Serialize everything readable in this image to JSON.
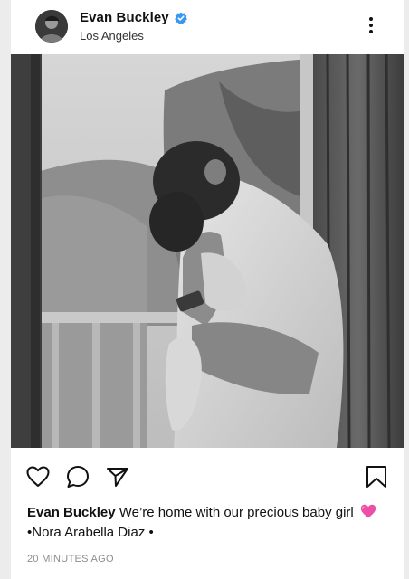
{
  "post": {
    "username": "Evan Buckley",
    "location": "Los Angeles",
    "verified": true,
    "caption_user": "Evan Buckley",
    "caption_line1": "We’re home with our precious baby girl",
    "caption_emoji": "pink-heart-emoji",
    "caption_line2": "•Nora Arabella Diaz •",
    "timestamp": "20 MINUTES AGO"
  },
  "icons": {
    "verified": "verified-badge-icon",
    "more": "more-options-icon",
    "like": "heart-outline-icon",
    "comment": "comment-bubble-icon",
    "share": "paper-plane-icon",
    "save": "bookmark-icon"
  },
  "colors": {
    "verified_blue": "#3897f0",
    "emoji_pink": "#ec4fa6",
    "timestamp_gray": "#8e8e8e"
  },
  "photo": {
    "style": "black-and-white",
    "subject": "man-holding-newborn"
  }
}
